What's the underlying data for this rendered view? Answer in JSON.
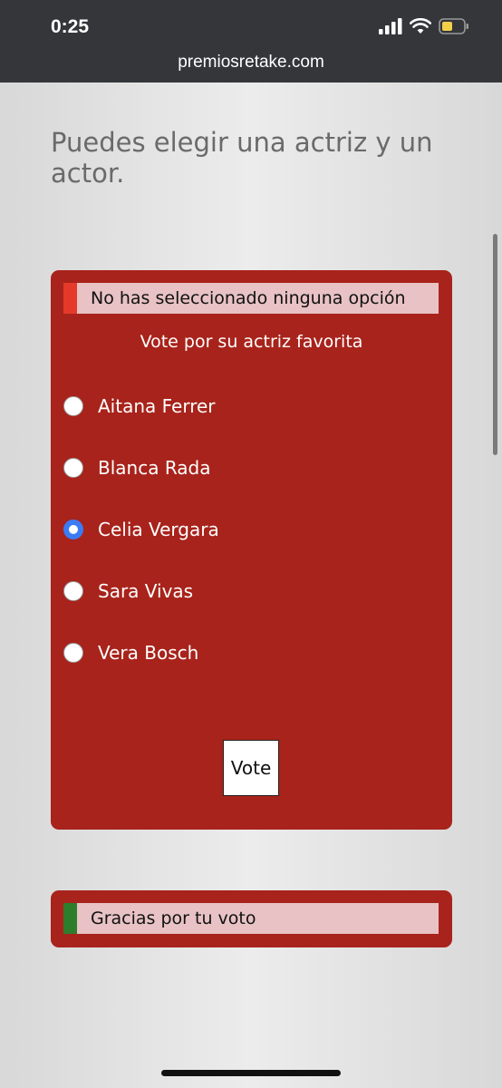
{
  "status_bar": {
    "time": "0:25"
  },
  "browser": {
    "url": "premiosretake.com"
  },
  "intro": {
    "text": "Puedes elegir una actriz y un actor."
  },
  "vote_card": {
    "error_message": "No has seleccionado ninguna opción",
    "question": "Vote por su actriz favorita",
    "options": [
      {
        "label": "Aitana Ferrer",
        "selected": false
      },
      {
        "label": "Blanca Rada",
        "selected": false
      },
      {
        "label": "Celia Vergara",
        "selected": true
      },
      {
        "label": "Sara Vivas",
        "selected": false
      },
      {
        "label": "Vera Bosch",
        "selected": false
      }
    ],
    "vote_label": "Vote"
  },
  "thanks_card": {
    "message": "Gracias por tu voto"
  },
  "colors": {
    "card_bg": "#a8231b",
    "error_bar": "#e53a2b",
    "success_bar": "#2e7d2c",
    "radio_selected": "#3b7cf5"
  }
}
